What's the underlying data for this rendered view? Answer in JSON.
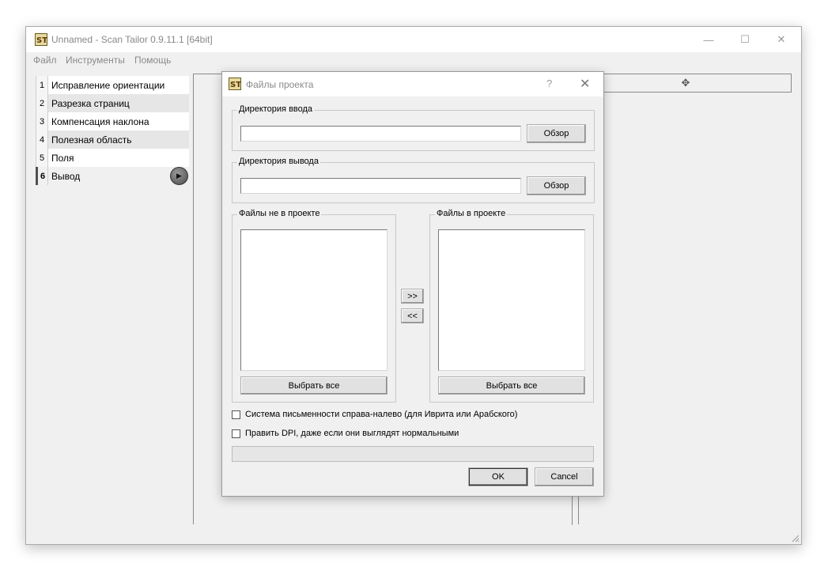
{
  "window": {
    "title": "Unnamed - Scan Tailor 0.9.11.1 [64bit]",
    "controls": {
      "minimize": "—",
      "maximize": "☐",
      "close": "✕"
    }
  },
  "menu": {
    "file": "Файл",
    "tools": "Инструменты",
    "help": "Помощь"
  },
  "stages": [
    {
      "num": "1",
      "label": "Исправление ориентации"
    },
    {
      "num": "2",
      "label": "Разрезка страниц"
    },
    {
      "num": "3",
      "label": "Компенсация наклона"
    },
    {
      "num": "4",
      "label": "Полезная область"
    },
    {
      "num": "5",
      "label": "Поля"
    },
    {
      "num": "6",
      "label": "Вывод"
    }
  ],
  "dialog": {
    "title": "Файлы проекта",
    "help": "?",
    "close": "✕",
    "input_dir": {
      "title": "Директория ввода",
      "value": "",
      "browse": "Обзор"
    },
    "output_dir": {
      "title": "Директория вывода",
      "value": "",
      "browse": "Обзор"
    },
    "files_out": {
      "title": "Файлы не в проекте",
      "select_all": "Выбрать все"
    },
    "files_in": {
      "title": "Файлы в проекте",
      "select_all": "Выбрать все"
    },
    "add_btn": ">>",
    "remove_btn": "<<",
    "rtl_checkbox": "Система письменности справа-налево (для Иврита или Арабского)",
    "fix_dpi_checkbox": "Править DPI, даже если они выглядят нормальными",
    "ok": "OK",
    "cancel": "Cancel"
  }
}
